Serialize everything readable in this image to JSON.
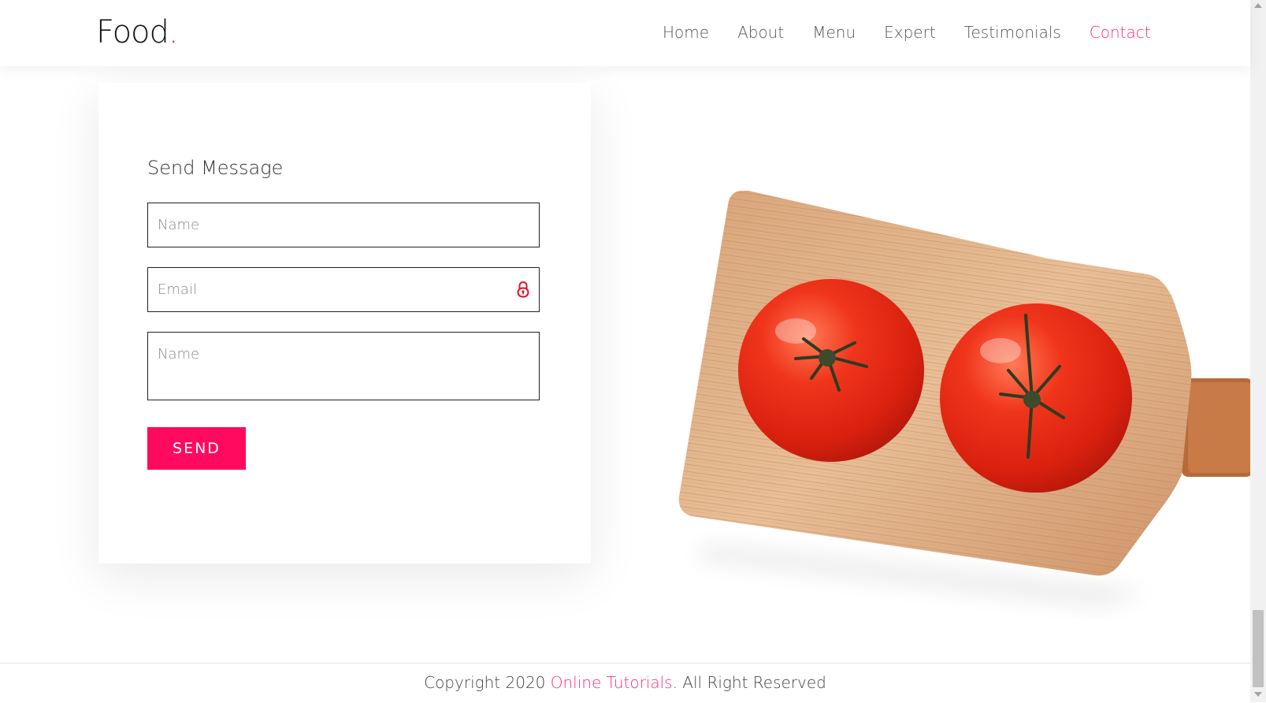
{
  "header": {
    "logo_text": "Food",
    "logo_dot": ".",
    "nav": [
      {
        "label": "Home"
      },
      {
        "label": "About"
      },
      {
        "label": "Menu"
      },
      {
        "label": "Expert"
      },
      {
        "label": "Testimonials"
      },
      {
        "label": "Contact",
        "active": true
      }
    ]
  },
  "contact_form": {
    "title": "Send Message",
    "name_placeholder": "Name",
    "email_placeholder": "Email",
    "message_placeholder": "Name",
    "send_label": "SEND",
    "email_icon": "lock-icon"
  },
  "hero_image": {
    "subject": "tomatoes-on-cutting-board"
  },
  "footer": {
    "prefix": "Copyright 2020 ",
    "link": "Online Tutorials",
    "suffix": ". All Right Reserved"
  },
  "colors": {
    "accent": "#ff0a5f",
    "nav_active": "#ff2d75",
    "text": "#111111"
  }
}
